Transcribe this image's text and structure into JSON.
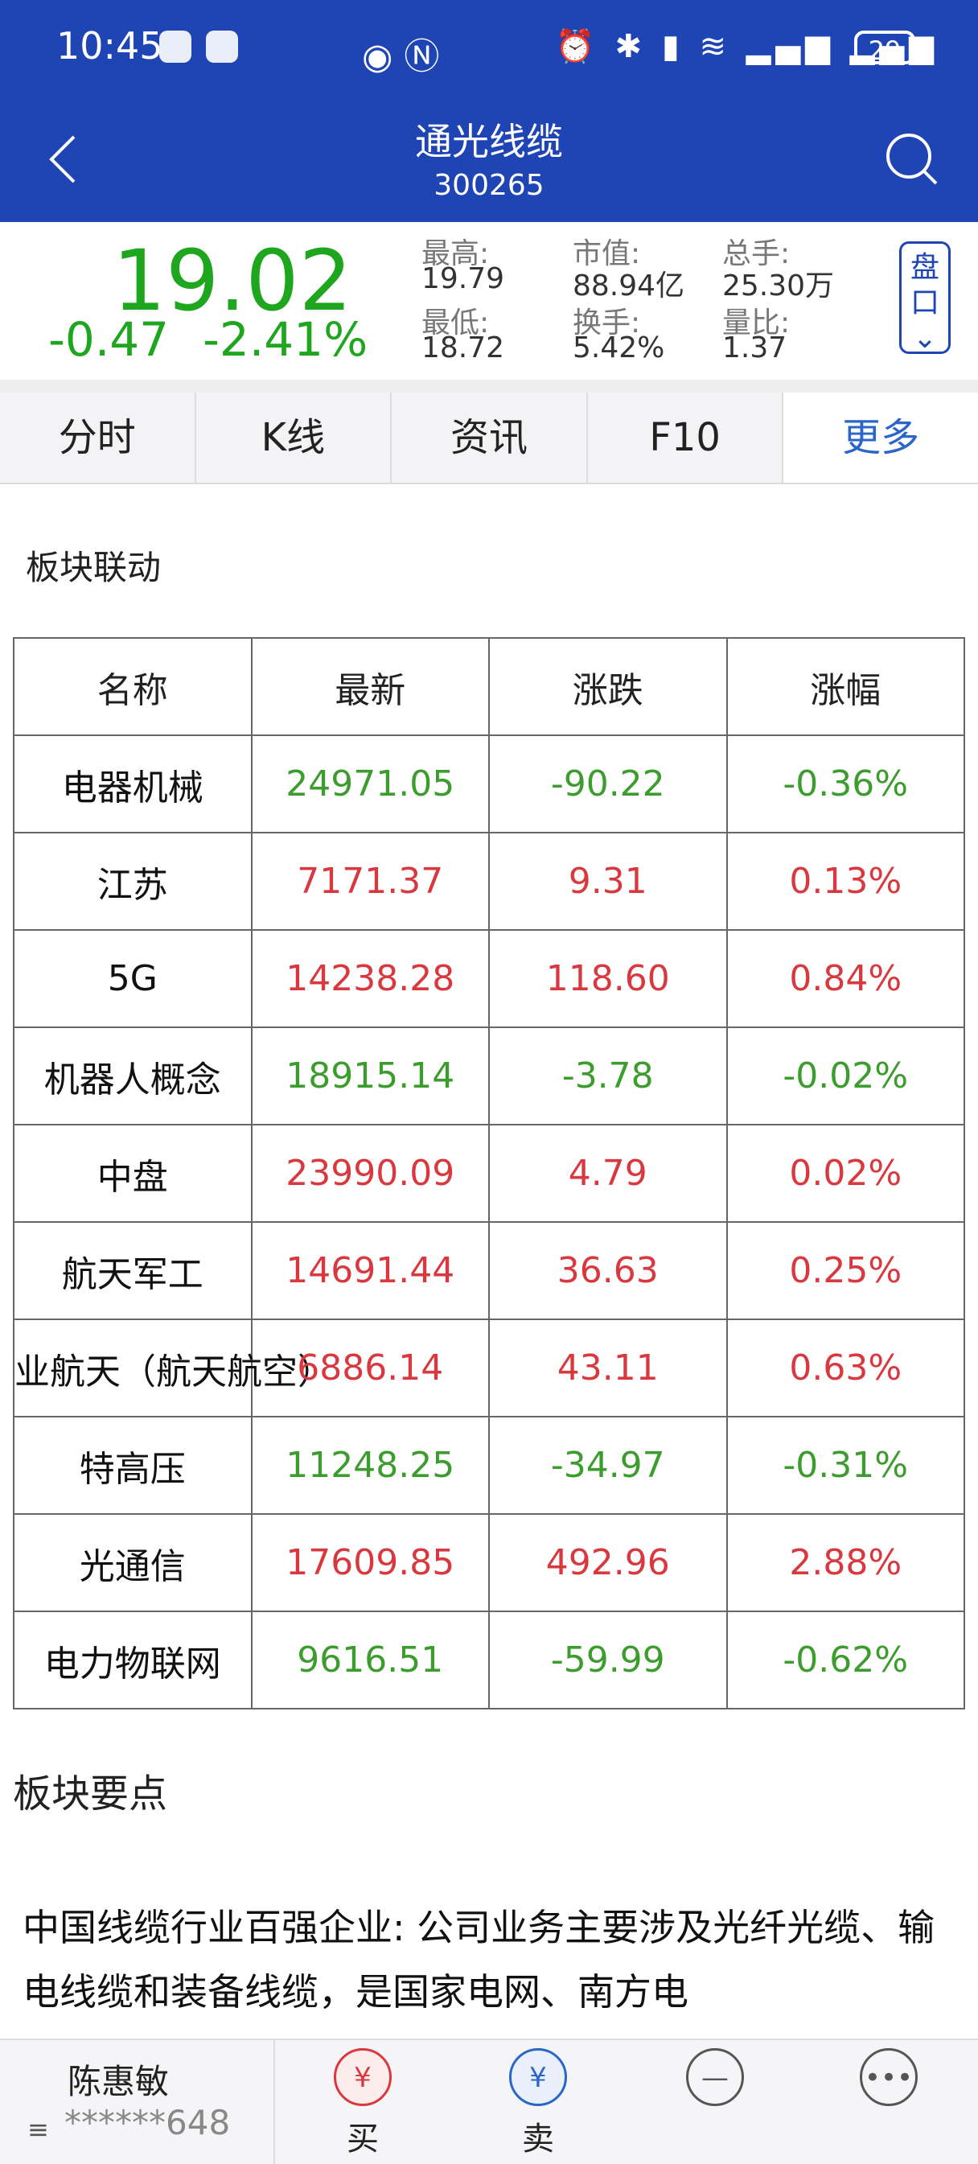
{
  "status_bar": {
    "time": "10:45",
    "battery": "29"
  },
  "header": {
    "stock_name": "通光线缆",
    "stock_code": "300265"
  },
  "quote": {
    "price": "19.02",
    "change": "-0.47",
    "change_pct": "-2.41%",
    "stats": [
      {
        "label": "最高:",
        "value": "19.79"
      },
      {
        "label": "市值:",
        "value": "88.94亿"
      },
      {
        "label": "总手:",
        "value": "25.30万"
      },
      {
        "label": "最低:",
        "value": "18.72"
      },
      {
        "label": "换手:",
        "value": "5.42%"
      },
      {
        "label": "量比:",
        "value": "1.37"
      }
    ],
    "panel_button": "盘口"
  },
  "tabs": [
    "分时",
    "K线",
    "资讯",
    "F10",
    "更多"
  ],
  "sector_linkage": {
    "title": "板块联动",
    "columns": [
      "名称",
      "最新",
      "涨跌",
      "涨幅"
    ],
    "rows": [
      {
        "name": "电器机械",
        "latest": "24971.05",
        "change": "-90.22",
        "pct": "-0.36%",
        "dir": "down"
      },
      {
        "name": "江苏",
        "latest": "7171.37",
        "change": "9.31",
        "pct": "0.13%",
        "dir": "up"
      },
      {
        "name": "5G",
        "latest": "14238.28",
        "change": "118.60",
        "pct": "0.84%",
        "dir": "up"
      },
      {
        "name": "机器人概念",
        "latest": "18915.14",
        "change": "-3.78",
        "pct": "-0.02%",
        "dir": "down"
      },
      {
        "name": "中盘",
        "latest": "23990.09",
        "change": "4.79",
        "pct": "0.02%",
        "dir": "up"
      },
      {
        "name": "航天军工",
        "latest": "14691.44",
        "change": "36.63",
        "pct": "0.25%",
        "dir": "up"
      },
      {
        "name": "业航天（航天航空）",
        "latest": "6886.14",
        "change": "43.11",
        "pct": "0.63%",
        "dir": "up"
      },
      {
        "name": "特高压",
        "latest": "11248.25",
        "change": "-34.97",
        "pct": "-0.31%",
        "dir": "down"
      },
      {
        "name": "光通信",
        "latest": "17609.85",
        "change": "492.96",
        "pct": "2.88%",
        "dir": "up"
      },
      {
        "name": "电力物联网",
        "latest": "9616.51",
        "change": "-59.99",
        "pct": "-0.62%",
        "dir": "down"
      }
    ]
  },
  "sector_points": {
    "title": "板块要点",
    "text": "中国线缆行业百强企业: 公司业务主要涉及光纤光缆、输电线缆和装备线缆，是国家电网、南方电"
  },
  "bottom_bar": {
    "user_name": "陈惠敏",
    "account": "******648",
    "buy": "买",
    "sell": "卖"
  },
  "colors": {
    "brand": "#1f45b5",
    "up": "#d9383f",
    "down": "#3c9d2e",
    "price_green": "#1ea61e"
  }
}
